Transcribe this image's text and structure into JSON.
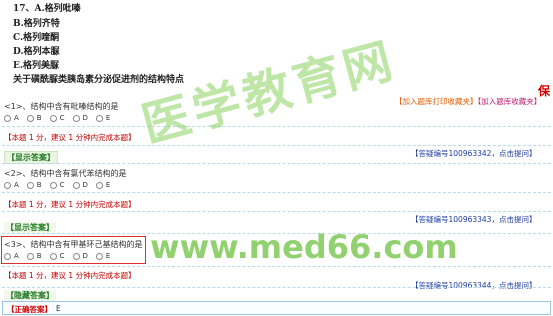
{
  "top_options": [
    "17、A.格列吡嗪",
    "B.格列齐特",
    "C.格列喹酮",
    "D.格列本脲",
    "E.格列美脲"
  ],
  "group_stem": "关于磺酰脲类胰岛素分泌促进剂的结构特点",
  "side_char": "保",
  "add_links": {
    "print_fav": "【加入题库打印收藏夹】",
    "fav": "【加入题库收藏夹】"
  },
  "choices": [
    "A",
    "B",
    "C",
    "D",
    "E"
  ],
  "questions": [
    {
      "stem": "<1>、结构中含有吡嗪结构的是",
      "note": "【本题 1 分，建议 1 分钟内完成本题】",
      "qa_link": "【答疑编号100963342，点击提问】"
    },
    {
      "stem": "<2>、结构中含有氯代苯结构的是",
      "note": "【本题 1 分，建议 1 分钟内完成本题】",
      "qa_link": "【答疑编号100963343，点击提问】"
    },
    {
      "stem": "<3>、结构中含有甲基环己基结构的是",
      "note": "【本题 1 分，建议 1 分钟内完成本题】",
      "qa_link": "【答疑编号100963344，点击提问】"
    }
  ],
  "show_answer": "【显示答案】",
  "hide_answer": "【隐藏答案】",
  "correct_answer_label": "【正确答案】",
  "correct_answer_value": "E",
  "watermark_cn": "医学教育网",
  "watermark_url": "www.med66.com"
}
